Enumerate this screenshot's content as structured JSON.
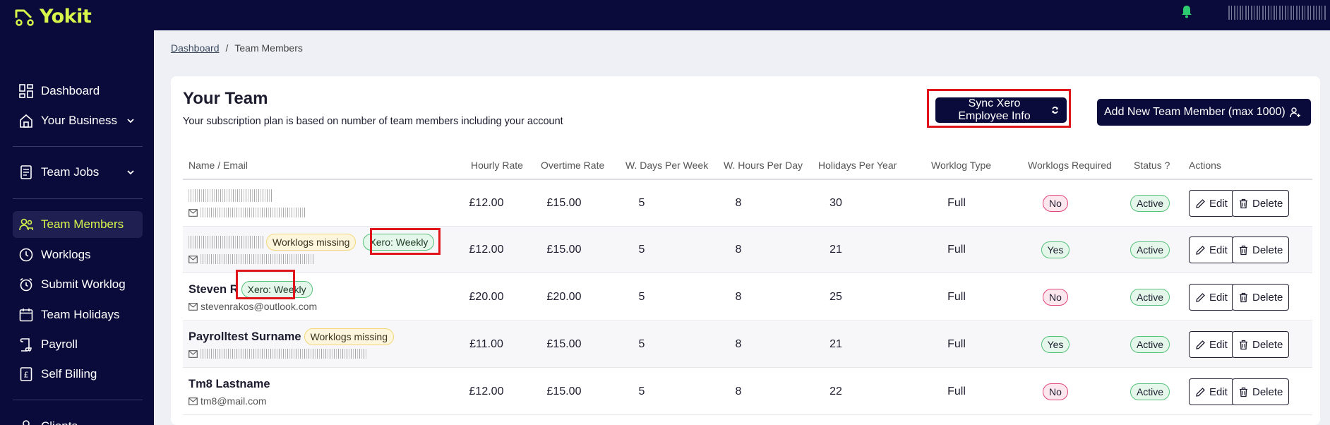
{
  "app": {
    "logo_text": "Yokit",
    "accent": "#d7f54a",
    "brand_dark": "#0b0b3b"
  },
  "sidebar": {
    "items": [
      {
        "label": "Dashboard",
        "icon": "dashboard-icon"
      },
      {
        "label": "Your Business",
        "icon": "home-icon",
        "expandable": true
      },
      {
        "label": "Team Jobs",
        "icon": "jobs-icon",
        "expandable": true
      },
      {
        "label": "Team Members",
        "icon": "team-icon",
        "active": true
      },
      {
        "label": "Worklogs",
        "icon": "clock-icon"
      },
      {
        "label": "Submit Worklog",
        "icon": "alarm-icon"
      },
      {
        "label": "Team Holidays",
        "icon": "calendar-icon"
      },
      {
        "label": "Payroll",
        "icon": "payroll-icon"
      },
      {
        "label": "Self Billing",
        "icon": "pound-icon"
      },
      {
        "label": "Clients",
        "icon": "clients-icon"
      }
    ]
  },
  "breadcrumb": {
    "home": "Dashboard",
    "separator": "/",
    "current": "Team Members"
  },
  "page": {
    "title": "Your Team",
    "subtitle": "Your subscription plan is based on number of team members including your account",
    "sync_button": "Sync Xero Employee Info",
    "add_button": "Add New Team Member (max 1000)"
  },
  "table": {
    "headers": [
      "Name / Email",
      "Hourly Rate",
      "Overtime Rate",
      "W. Days Per Week",
      "W. Hours Per Day",
      "Holidays Per Year",
      "Worklog Type",
      "Worklogs Required",
      "Status ?",
      "Actions"
    ],
    "edit_label": "Edit",
    "delete_label": "Delete",
    "rows": [
      {
        "name": "",
        "email": "",
        "badges": [],
        "hourly": "£12.00",
        "overtime": "£15.00",
        "days": "5",
        "hours": "8",
        "holidays": "30",
        "type": "Full",
        "required": "No",
        "status": "Active"
      },
      {
        "name": "",
        "email": "",
        "badges": [
          "Worklogs missing",
          "Xero: Weekly"
        ],
        "hourly": "£12.00",
        "overtime": "£15.00",
        "days": "5",
        "hours": "8",
        "holidays": "21",
        "type": "Full",
        "required": "Yes",
        "status": "Active"
      },
      {
        "name": "Steven R",
        "email": "stevenrakos@outlook.com",
        "badges": [
          "Xero: Weekly"
        ],
        "hourly": "£20.00",
        "overtime": "£20.00",
        "days": "5",
        "hours": "8",
        "holidays": "25",
        "type": "Full",
        "required": "No",
        "status": "Active"
      },
      {
        "name": "Payrolltest Surname",
        "email": "",
        "badges": [
          "Worklogs missing"
        ],
        "hourly": "£11.00",
        "overtime": "£15.00",
        "days": "5",
        "hours": "8",
        "holidays": "21",
        "type": "Full",
        "required": "Yes",
        "status": "Active"
      },
      {
        "name": "Tm8 Lastname",
        "email": "tm8@mail.com",
        "badges": [],
        "hourly": "£12.00",
        "overtime": "£15.00",
        "days": "5",
        "hours": "8",
        "holidays": "22",
        "type": "Full",
        "required": "No",
        "status": "Active"
      }
    ]
  }
}
